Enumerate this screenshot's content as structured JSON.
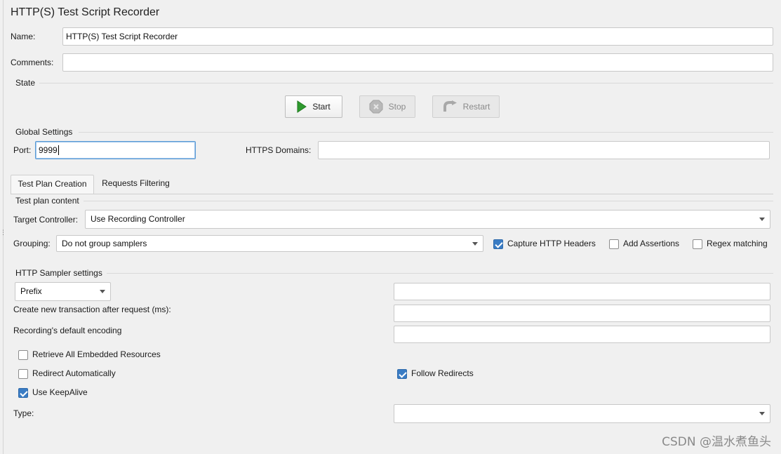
{
  "window": {
    "title": "HTTP(S) Test Script Recorder"
  },
  "form": {
    "name_label": "Name:",
    "name_value": "HTTP(S) Test Script Recorder",
    "comments_label": "Comments:",
    "comments_value": ""
  },
  "state": {
    "section_label": "State",
    "start_label": "Start",
    "stop_label": "Stop",
    "restart_label": "Restart"
  },
  "global": {
    "section_label": "Global Settings",
    "port_label": "Port:",
    "port_value": "9999",
    "https_domains_label": "HTTPS Domains:",
    "https_domains_value": ""
  },
  "tabs": [
    {
      "label": "Test Plan Creation",
      "active": true
    },
    {
      "label": "Requests Filtering",
      "active": false
    }
  ],
  "test_plan": {
    "section_label": "Test plan content",
    "target_controller_label": "Target Controller:",
    "target_controller_value": "Use Recording Controller",
    "grouping_label": "Grouping:",
    "grouping_value": "Do not group samplers",
    "capture_headers_label": "Capture HTTP Headers",
    "capture_headers_checked": true,
    "add_assertions_label": "Add Assertions",
    "add_assertions_checked": false,
    "regex_matching_label": "Regex matching",
    "regex_matching_checked": false
  },
  "sampler": {
    "section_label": "HTTP Sampler settings",
    "naming_scheme_value": "Prefix",
    "prefix_value": "",
    "transaction_label": "Create new transaction after request (ms):",
    "transaction_value": "",
    "encoding_label": "Recording's default encoding",
    "encoding_value": "",
    "retrieve_embedded_label": "Retrieve All Embedded Resources",
    "retrieve_embedded_checked": false,
    "redirect_auto_label": "Redirect Automatically",
    "redirect_auto_checked": false,
    "follow_redirects_label": "Follow Redirects",
    "follow_redirects_checked": true,
    "keepalive_label": "Use KeepAlive",
    "keepalive_checked": true,
    "type_label": "Type:",
    "type_value": ""
  },
  "watermark": "CSDN @温水煮鱼头",
  "colors": {
    "accent": "#3a7cc4",
    "start_icon": "#2e9a2e",
    "background": "#f0f0f0"
  }
}
